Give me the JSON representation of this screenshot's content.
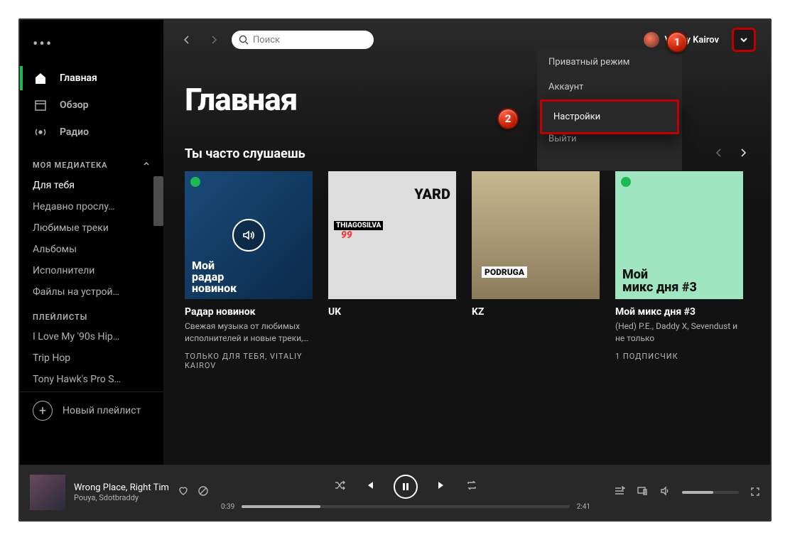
{
  "window": {
    "minimize": "—",
    "maximize": "▢",
    "close": "✕"
  },
  "user": {
    "name": "Vitaliy Kairov"
  },
  "search": {
    "placeholder": "Поиск"
  },
  "nav": {
    "home": "Главная",
    "browse": "Обзор",
    "radio": "Радио"
  },
  "library": {
    "header": "МОЯ МЕДИАТЕКА",
    "items": [
      "Для тебя",
      "Недавно прослу…",
      "Любимые треки",
      "Альбомы",
      "Исполнители",
      "Файлы на устрой…"
    ]
  },
  "playlists": {
    "header": "ПЛЕЙЛИСТЫ",
    "items": [
      "I Love My '90s Hip…",
      "Trip Hop",
      "Tony Hawk's Pro S…"
    ]
  },
  "newPlaylist": "Новый плейлист",
  "page": {
    "title": "Главная"
  },
  "section": {
    "title": "Ты часто слушаешь"
  },
  "dropdown": {
    "private": "Приватный режим",
    "account": "Аккаунт",
    "settings": "Настройки",
    "logout": "Выйти"
  },
  "callouts": {
    "one": "1",
    "two": "2"
  },
  "cards": [
    {
      "coverText1": "Мой",
      "coverText2": "радар",
      "coverText3": "новинок",
      "title": "Радар новинок",
      "sub": "Свежая музыка от любимых исполнителей и новые треки,…",
      "meta": "ТОЛЬКО ДЛЯ ТЕБЯ, VITALIY KAIROV"
    },
    {
      "coverA": "YARD",
      "coverB": "THIAGOSILVA",
      "coverC": "99",
      "title": "UK",
      "sub": "",
      "meta": ""
    },
    {
      "coverA": "PODRUGA",
      "title": "KZ",
      "sub": "",
      "meta": ""
    },
    {
      "coverA": "Мой",
      "coverB": "микс дня #3",
      "title": "Мой микс дня #3",
      "sub": "(Hed) P.E., Daddy X, Sevendust и не только",
      "meta": "1 ПОДПИСЧИК"
    }
  ],
  "player": {
    "title": "Wrong Place, Right Tim",
    "artist": "Pouya, Sdotbraddy",
    "elapsed": "0:39",
    "total": "2:41"
  }
}
